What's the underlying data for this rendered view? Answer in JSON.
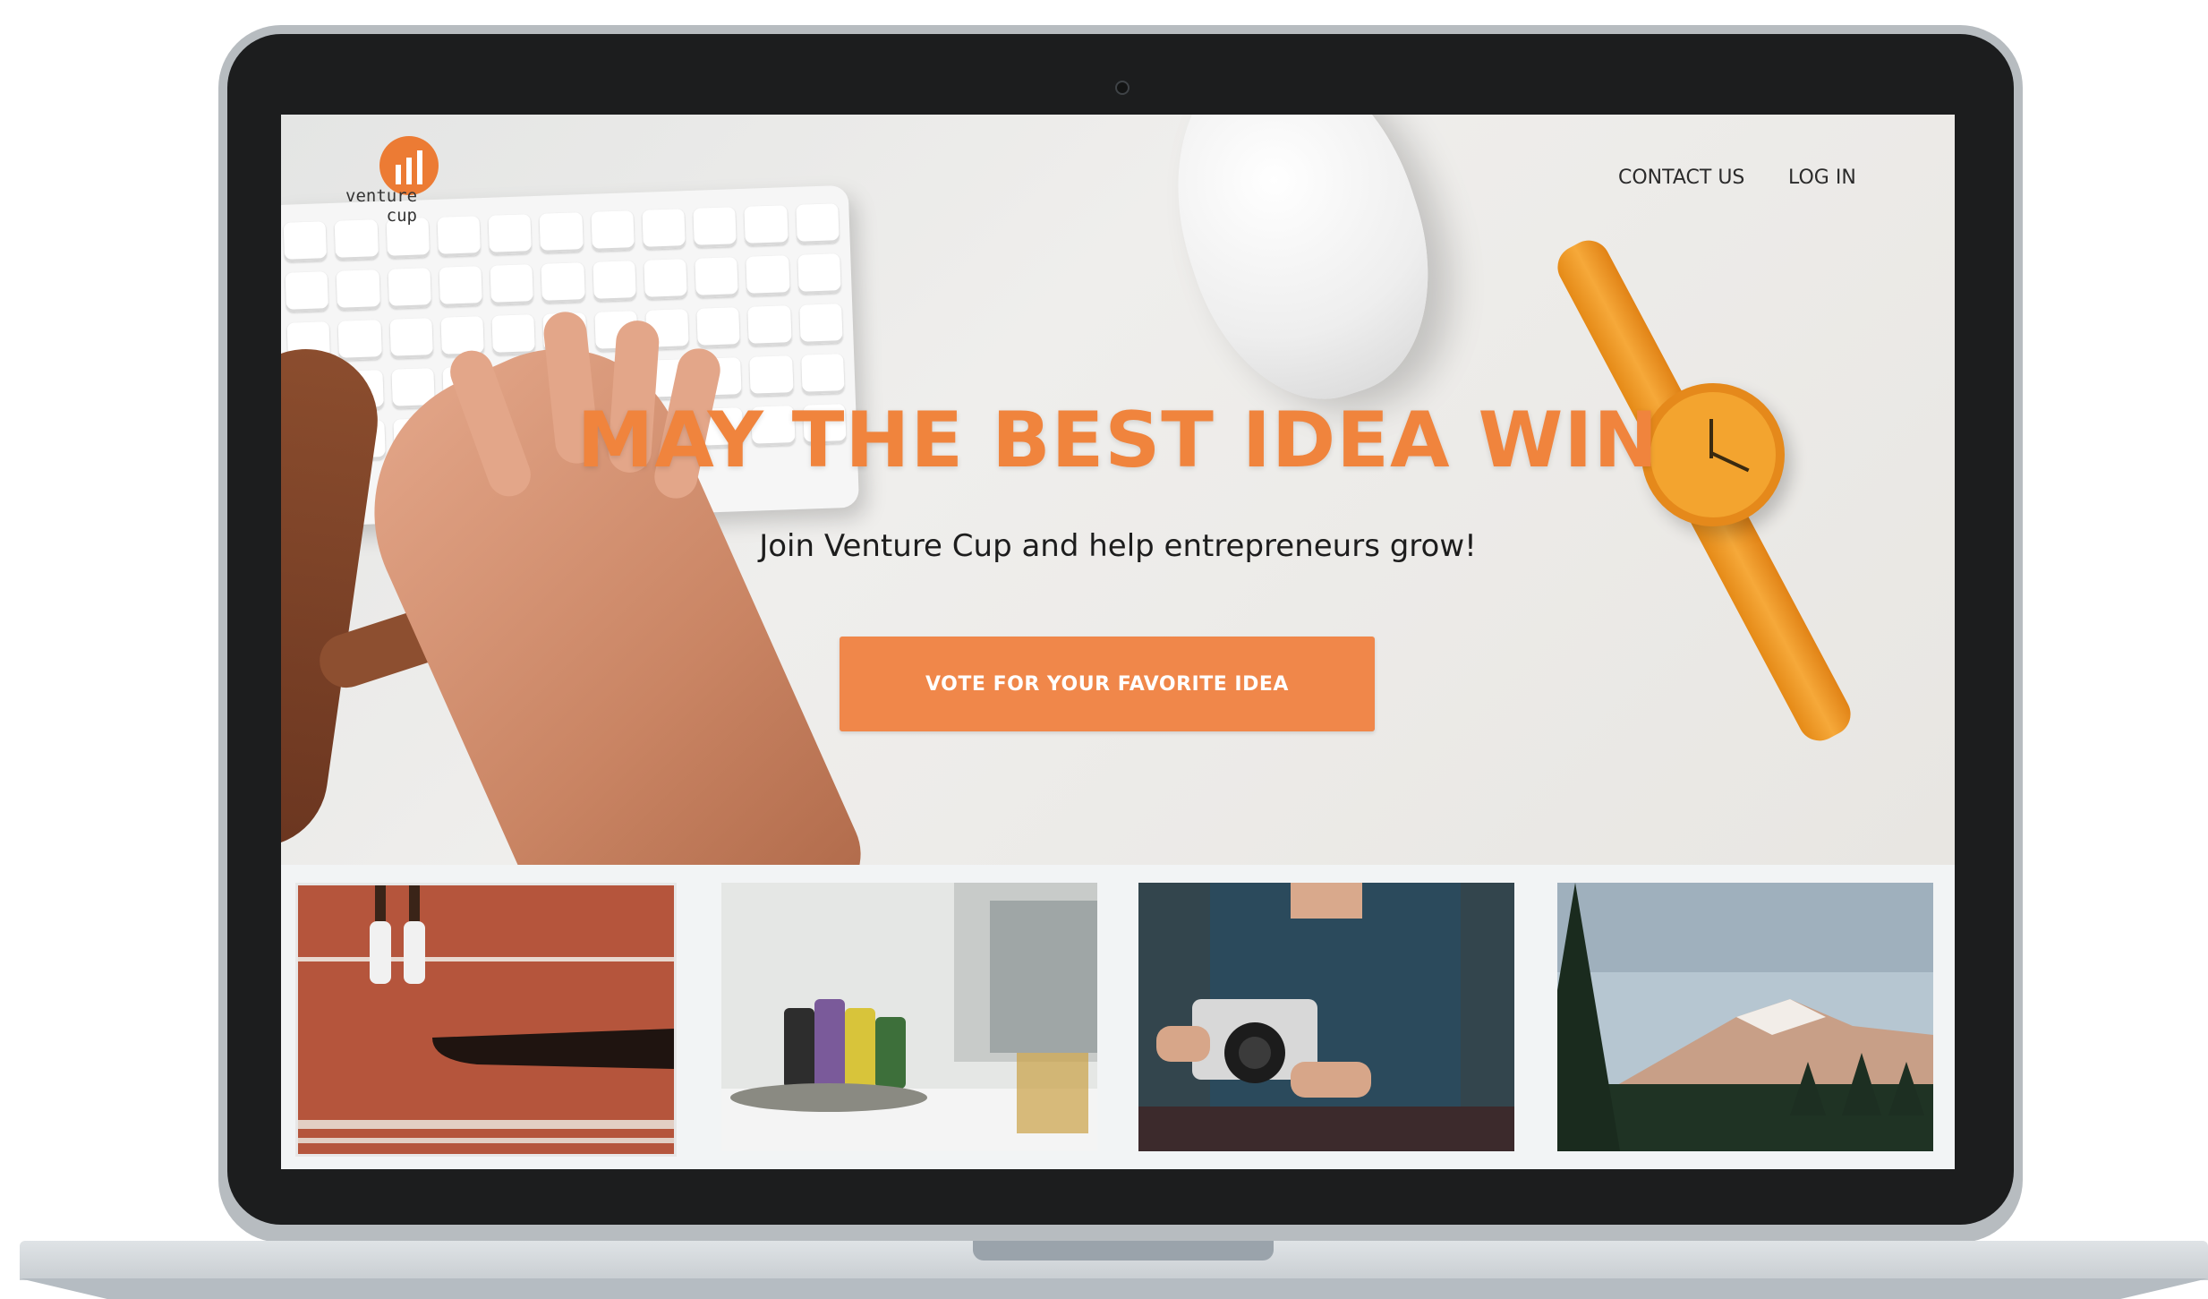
{
  "brand": {
    "logo_line1": "venture",
    "logo_line2": "cup",
    "accent_color": "#f0843d"
  },
  "nav": {
    "contact_label": "CONTACT US",
    "login_label": "LOG IN"
  },
  "hero": {
    "headline": "MAY THE BEST IDEA WIN",
    "subheadline": "Join Venture Cup and help entrepreneurs grow!",
    "cta_label": "VOTE FOR YOUR FAVORITE IDEA"
  },
  "thumbnails": [
    {
      "subject": "running-track-jump"
    },
    {
      "subject": "film-rolls-desk"
    },
    {
      "subject": "person-with-camera"
    },
    {
      "subject": "mountain-forest"
    }
  ]
}
